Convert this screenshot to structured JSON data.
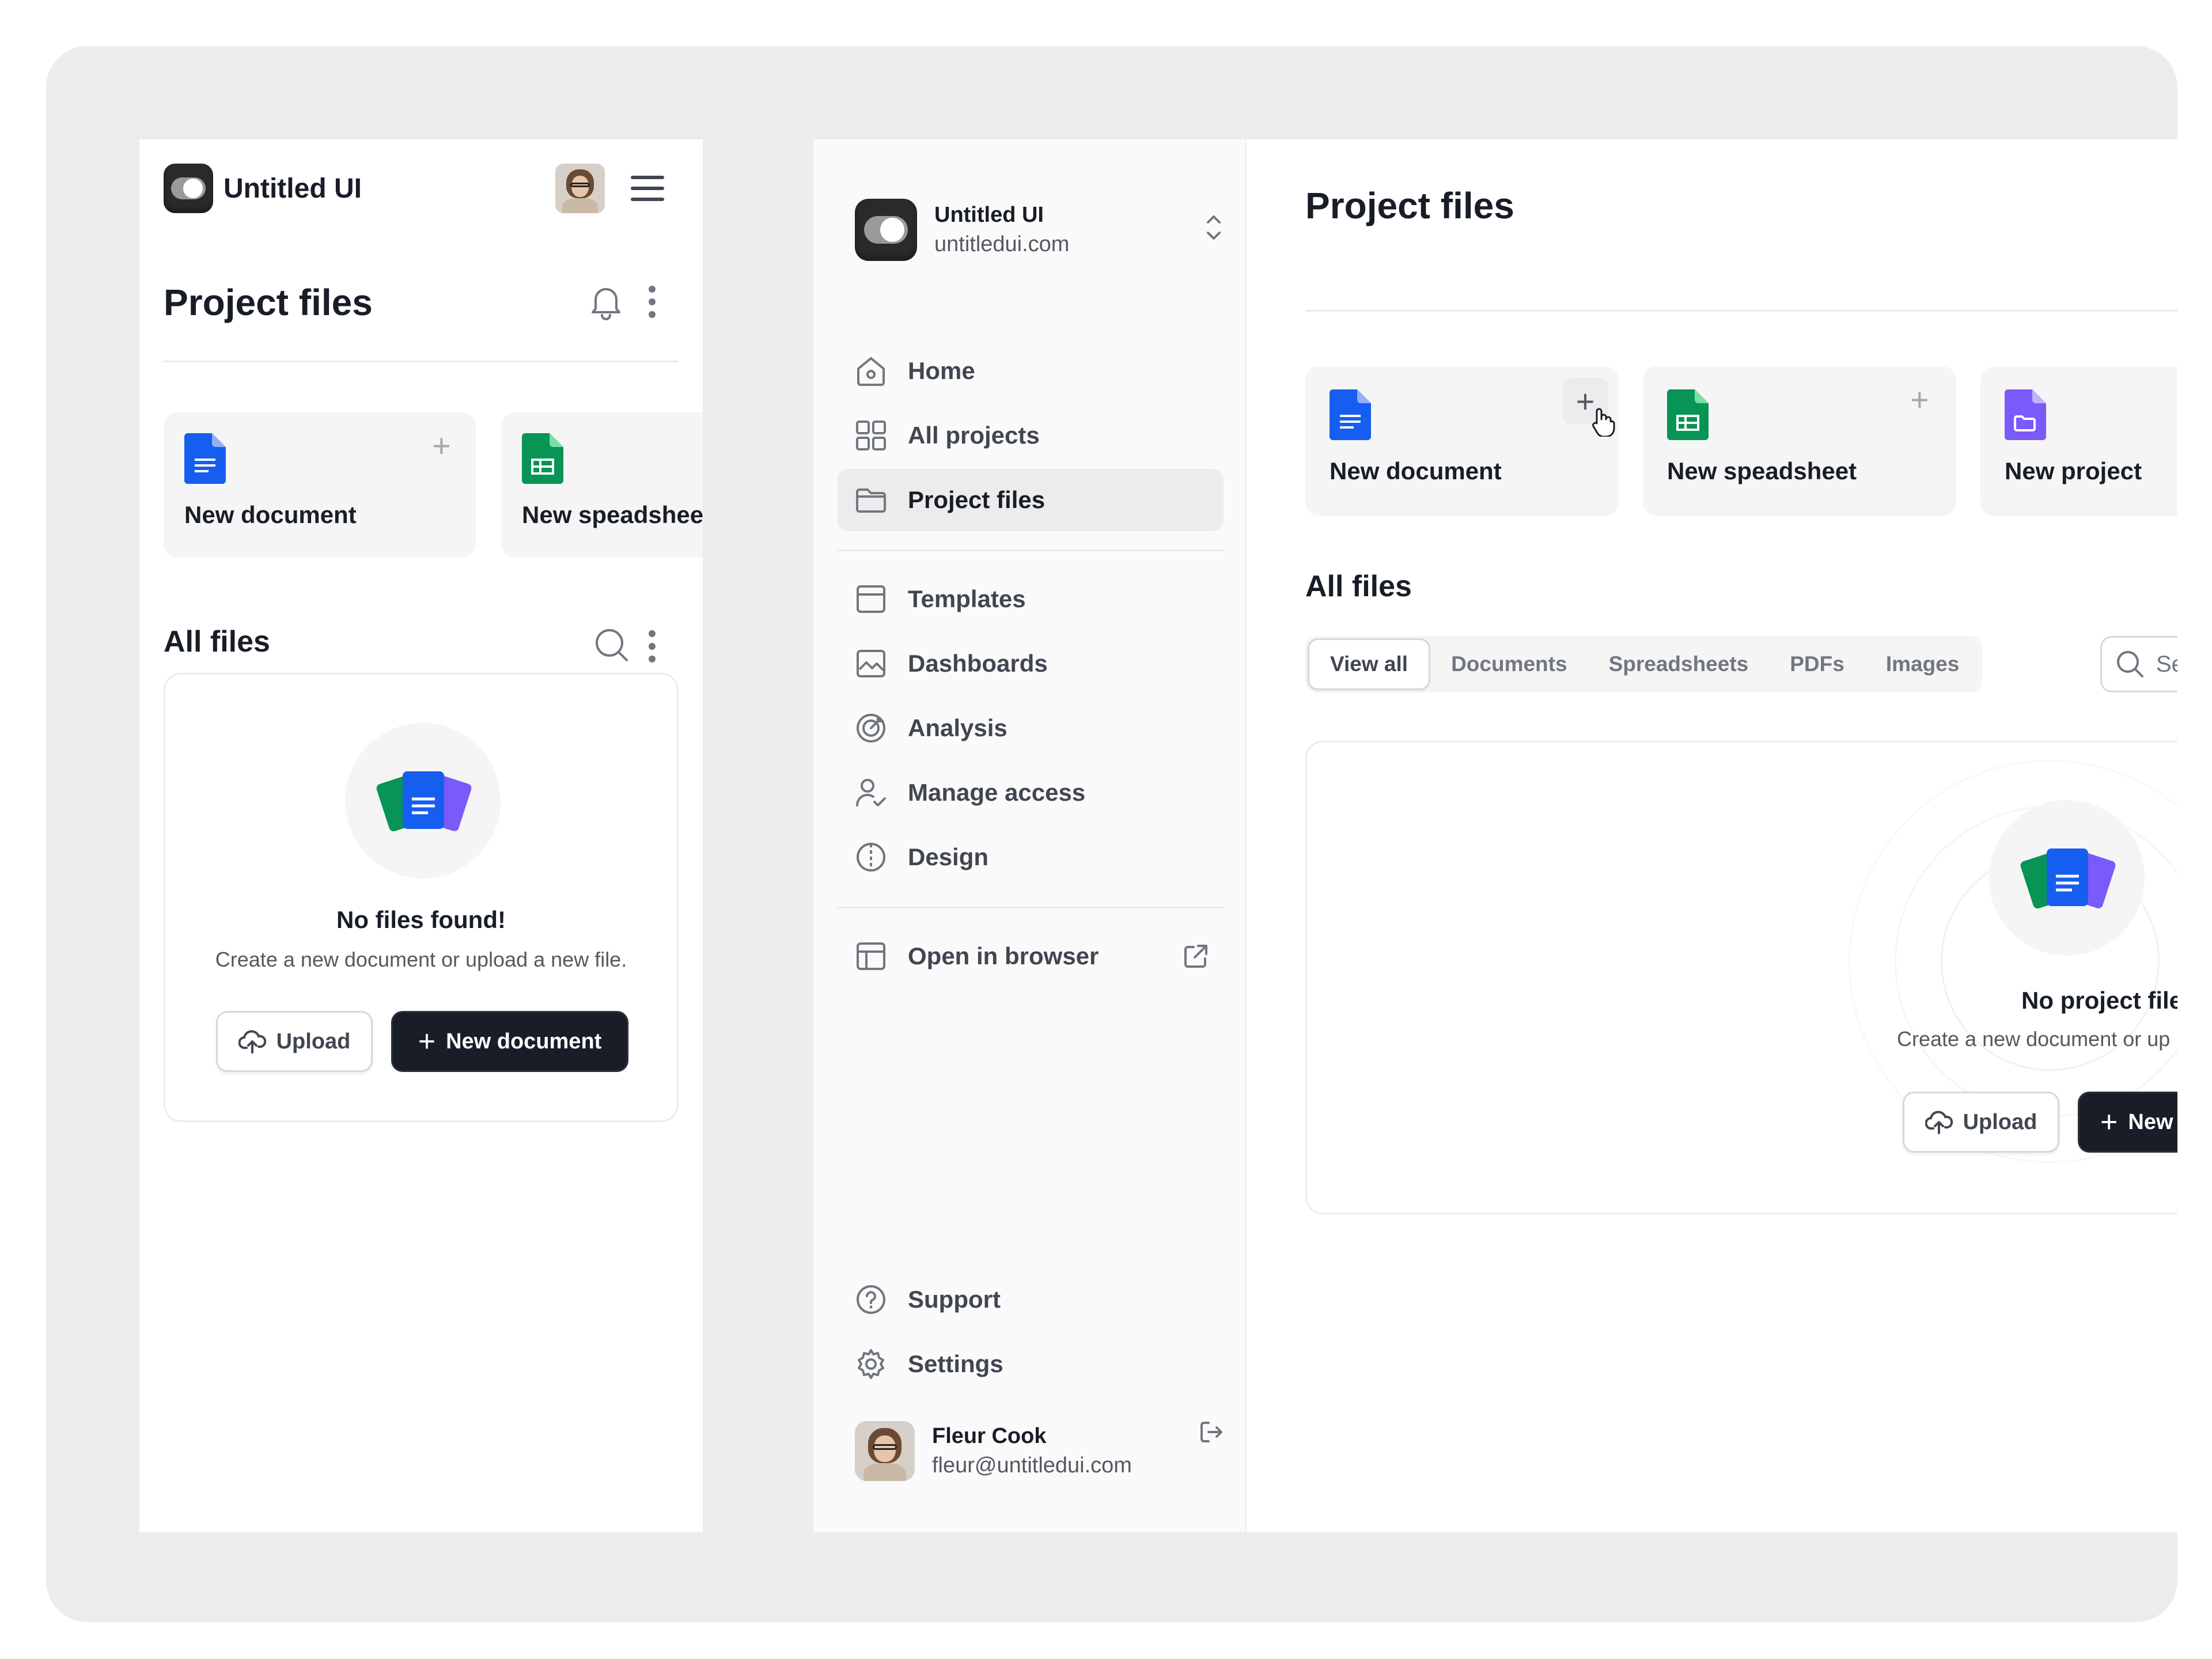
{
  "mobile": {
    "brand": "Untitled UI",
    "page_title": "Project files",
    "quick_actions": [
      {
        "label": "New document",
        "color": "#155eef"
      },
      {
        "label": "New speadsheet",
        "color": "#079455"
      }
    ],
    "all_files_title": "All files",
    "empty": {
      "title": "No files found!",
      "description": "Create a new document or upload a new file.",
      "upload_label": "Upload",
      "new_label": "New document"
    }
  },
  "sidebar": {
    "brand": "Untitled UI",
    "domain": "untitledui.com",
    "nav": [
      {
        "label": "Home",
        "icon": "home-icon"
      },
      {
        "label": "All projects",
        "icon": "grid-icon"
      },
      {
        "label": "Project files",
        "icon": "folder-icon",
        "active": true
      }
    ],
    "nav2": [
      {
        "label": "Templates",
        "icon": "layout-icon"
      },
      {
        "label": "Dashboards",
        "icon": "chart-icon"
      },
      {
        "label": "Analysis",
        "icon": "target-icon"
      },
      {
        "label": "Manage access",
        "icon": "users-check-icon"
      },
      {
        "label": "Design",
        "icon": "contrast-icon"
      }
    ],
    "open_browser": "Open in browser",
    "support": "Support",
    "settings": "Settings",
    "user": {
      "name": "Fleur Cook",
      "email": "fleur@untitledui.com"
    }
  },
  "main": {
    "page_title": "Project files",
    "quick_actions": [
      {
        "label": "New document",
        "color": "#155eef"
      },
      {
        "label": "New speadsheet",
        "color": "#079455"
      },
      {
        "label": "New project",
        "color": "#7a5af8"
      }
    ],
    "all_files_title": "All files",
    "tabs": [
      "View all",
      "Documents",
      "Spreadsheets",
      "PDFs",
      "Images"
    ],
    "active_tab": "View all",
    "search_placeholder": "Se",
    "empty": {
      "title": "No project file",
      "description": "Create a new document or up",
      "upload_label": "Upload",
      "new_label": "New"
    }
  }
}
